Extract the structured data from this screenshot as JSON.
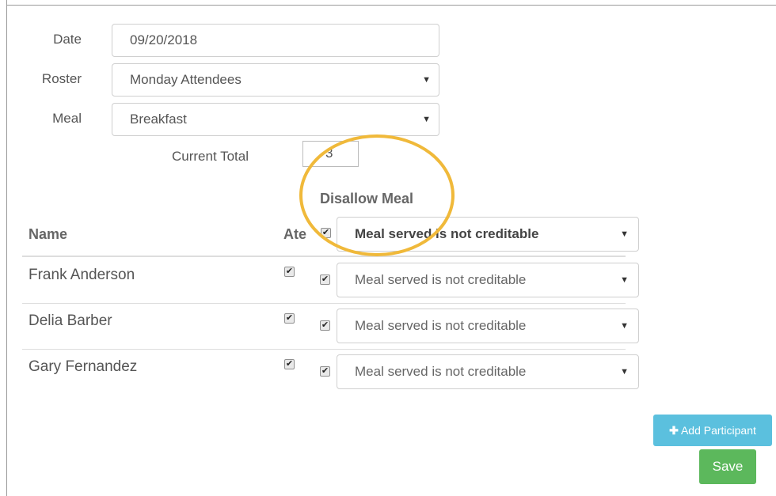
{
  "form": {
    "date_label": "Date",
    "date_value": "09/20/2018",
    "roster_label": "Roster",
    "roster_value": "Monday Attendees",
    "meal_label": "Meal",
    "meal_value": "Breakfast",
    "current_total_label": "Current Total",
    "current_total_value": "3"
  },
  "table": {
    "disallow_meal_label": "Disallow Meal",
    "header_name": "Name",
    "header_ate": "Ate",
    "header_reason": "Meal served is not creditable",
    "rows": [
      {
        "name": "Frank Anderson",
        "reason": "Meal served is not creditable"
      },
      {
        "name": "Delia Barber",
        "reason": "Meal served is not creditable"
      },
      {
        "name": "Gary Fernandez",
        "reason": "Meal served is not creditable"
      }
    ]
  },
  "buttons": {
    "add_participant": "Add Participant",
    "save": "Save"
  },
  "icons": {
    "dropdown": "chevron-down-icon",
    "check": "checkmark-icon",
    "add": "plus-icon"
  },
  "colors": {
    "highlight_circle": "#f0b93a",
    "add_button": "#5bc0de",
    "save_button": "#5cb85c"
  }
}
